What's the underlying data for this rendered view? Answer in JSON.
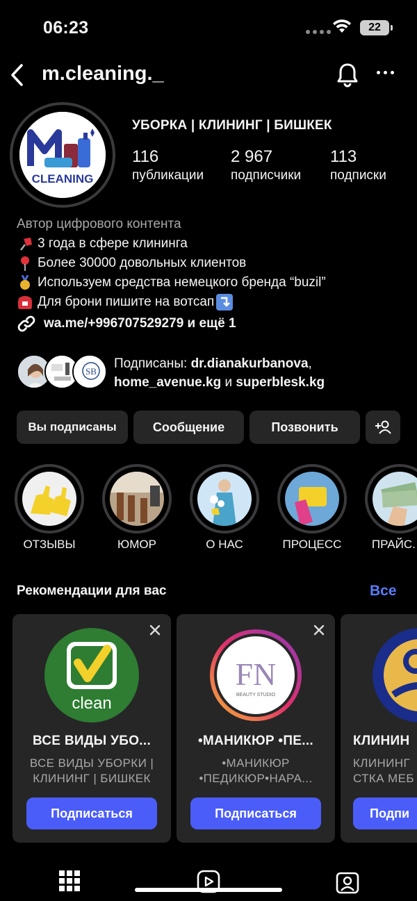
{
  "status": {
    "time": "06:23",
    "battery": "22"
  },
  "nav": {
    "username": "m.cleaning._"
  },
  "profile": {
    "category": "УБОРКА | КЛИНИНГ | БИШКЕК",
    "logo_text": "CLEANING",
    "stats": [
      {
        "num": "116",
        "label": "публикации"
      },
      {
        "num": "2 967",
        "label": "подписчики"
      },
      {
        "num": "113",
        "label": "подписки"
      }
    ]
  },
  "bio": {
    "category": "Автор цифрового контента",
    "lines": [
      {
        "icon": "pushpin-emoji",
        "text": "3 года в сфере клининга"
      },
      {
        "icon": "round-pushpin-emoji",
        "text": "Более 30000 довольных клиентов"
      },
      {
        "icon": "medal-emoji",
        "text": "Используем средства немецкого бренда “buzil”"
      },
      {
        "icon": "telephone-emoji",
        "text": "Для брони пишите на вотсап"
      }
    ],
    "link": "wa.me/+996707529279 и ещё 1"
  },
  "followed_by": {
    "prefix": "Подписаны: ",
    "user1": "dr.dianakurbanova",
    "sep1": ",",
    "user2": "home_avenue.kg",
    "and": " и ",
    "user3": "superblesk.kg"
  },
  "buttons": {
    "following": "Вы подписаны",
    "message": "Сообщение",
    "call": "Позвонить"
  },
  "highlights": [
    {
      "label": "ОТЗЫВЫ"
    },
    {
      "label": "ЮМОР"
    },
    {
      "label": "О НАС"
    },
    {
      "label": "ПРОЦЕСС"
    },
    {
      "label": "ПРАЙС. Ц"
    }
  ],
  "recommendations": {
    "title": "Рекомендации для вас",
    "see_all": "Все",
    "cards": [
      {
        "logo_text": "clean",
        "name": "ВСЕ ВИДЫ УБО...",
        "desc": "ВСЕ ВИДЫ УБОРКИ | КЛИНИНГ | БИШКЕК",
        "button": "Подписаться"
      },
      {
        "logo_text": "FN",
        "logo_sub": "BEAUTY STUDIO",
        "name": "•МАНИКЮР •ПЕ...",
        "desc": "•МАНИКЮР •ПЕДИКЮР•НАРА...",
        "button": "Подписаться"
      },
      {
        "name": "КЛИНИН",
        "desc": "КЛИНИНГ СТКА МЕБ",
        "button": "Подпи"
      }
    ]
  },
  "colors": {
    "background": "#000000",
    "button": "#262626",
    "accent": "#4a5df9",
    "link": "#5b7cf7"
  }
}
